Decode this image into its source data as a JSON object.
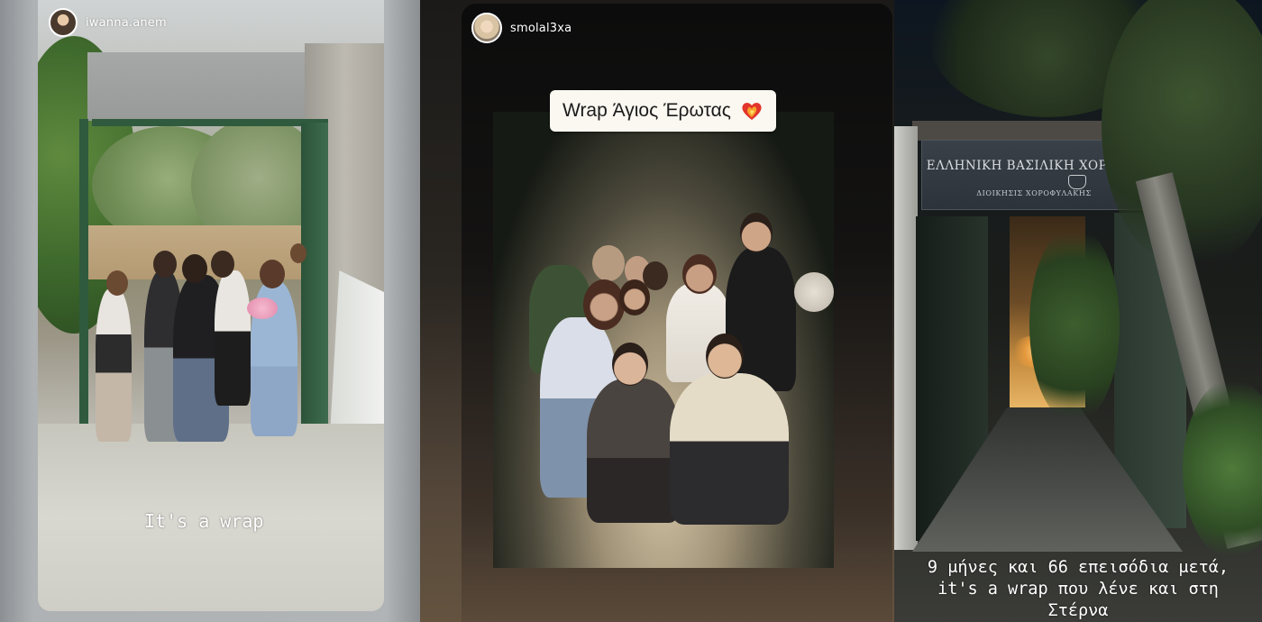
{
  "stories": [
    {
      "username": "iwanna.anem",
      "caption": "It's a wrap"
    },
    {
      "username": "smolal3xa",
      "sticker": {
        "text": "Wrap Άγιος Έρωτας",
        "emoji": "heart-on-fire"
      }
    },
    {
      "sign": {
        "title": "ΕΛΛΗΝΙΚΗ ΒΑΣΙΛΙΚΗ ΧΟΡΩΔΙΑ",
        "subtitle": "ΔΙΟΙΚΗΣΙΣ ΧΟΡΟΦΥΛΑΚΗΣ"
      },
      "caption_lines": [
        "9 μήνες και 66 επεισόδια μετά,",
        "it's a wrap που λένε και στη",
        "Στέρνα"
      ]
    }
  ]
}
